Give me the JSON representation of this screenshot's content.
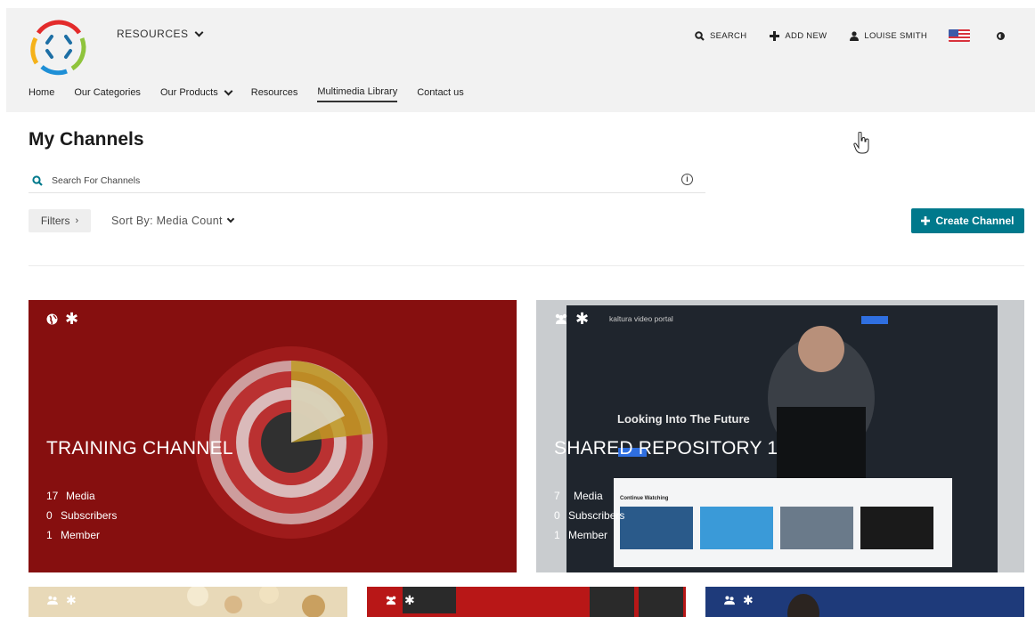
{
  "header": {
    "resources_label": "RESOURCES",
    "search_label": "SEARCH",
    "add_new_label": "ADD NEW",
    "user_label": "LOUISE SMITH"
  },
  "nav": {
    "items": [
      {
        "label": "Home"
      },
      {
        "label": "Our Categories"
      },
      {
        "label": "Our Products"
      },
      {
        "label": "Resources"
      },
      {
        "label": "Multimedia Library"
      },
      {
        "label": "Contact us"
      }
    ]
  },
  "page": {
    "title": "My Channels",
    "search_placeholder": "Search For Channels",
    "filters_label": "Filters",
    "sort_label": "Sort By: Media Count",
    "create_label": "Create Channel"
  },
  "channels": [
    {
      "title": "TRAINING CHANNEL",
      "media_count": "17",
      "media_label": "Media",
      "subscribers_count": "0",
      "subscribers_label": "Subscribers",
      "members_count": "1",
      "members_label": "Member"
    },
    {
      "title": "SHARED REPOSITORY 1",
      "media_count": "7",
      "media_label": "Media",
      "subscribers_count": "0",
      "subscribers_label": "Subscribers",
      "members_count": "1",
      "members_label": "Member",
      "thumb_text": {
        "brand": "kaltura video portal",
        "headline": "Looking Into The Future",
        "section": "Continue Watching"
      }
    }
  ],
  "colors": {
    "accent": "#00798c",
    "header_bg": "#f2f2f2",
    "card1_bg": "#8e1010"
  }
}
